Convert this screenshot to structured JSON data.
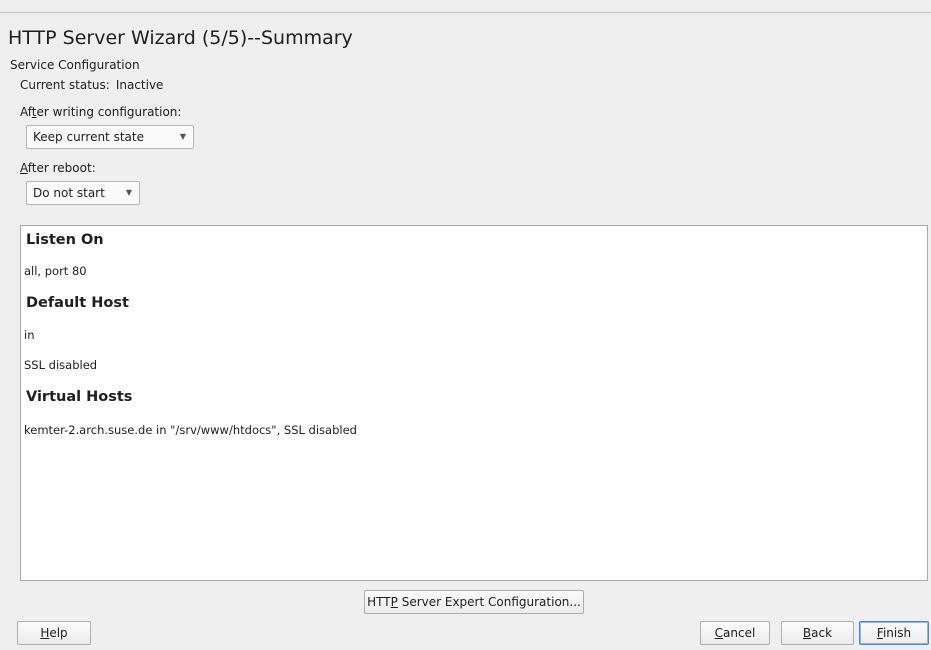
{
  "dialog": {
    "title": "HTTP Server Wizard (5/5)--Summary"
  },
  "service": {
    "section_label": "Service Configuration",
    "status_label": "Current status:",
    "status_value": "Inactive",
    "after_write": {
      "label_pre": "Af",
      "label_mnemonic": "t",
      "label_post": "er writing configuration:",
      "selected": "Keep current state"
    },
    "after_reboot": {
      "label_pre": "",
      "label_mnemonic": "A",
      "label_post": "fter reboot:",
      "selected": "Do not start"
    }
  },
  "summary": {
    "listen_heading": "Listen On",
    "listen_value": "all, port 80",
    "default_heading": "Default Host",
    "default_line1": "in",
    "default_line2": "SSL disabled",
    "virtual_heading": "Virtual Hosts",
    "virtual_value": "kemter-2.arch.suse.de in \"/srv/www/htdocs\", SSL disabled"
  },
  "expert_button": {
    "pre": "HTT",
    "mnemonic": "P",
    "post": " Server Expert Configuration..."
  },
  "footer": {
    "help": {
      "pre": "",
      "mnemonic": "H",
      "post": "elp"
    },
    "cancel": {
      "pre": "",
      "mnemonic": "C",
      "post": "ancel"
    },
    "back": {
      "pre": "",
      "mnemonic": "B",
      "post": "ack"
    },
    "finish": {
      "pre": "",
      "mnemonic": "F",
      "post": "inish"
    }
  }
}
